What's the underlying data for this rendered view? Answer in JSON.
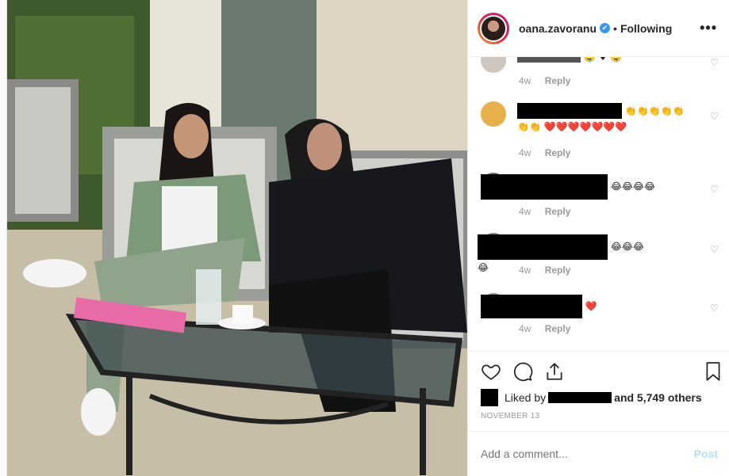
{
  "header": {
    "username": "oana.zavoranu",
    "verified_mark": "✔",
    "separator": "•",
    "follow_status": "Following",
    "more": "•••"
  },
  "comments": [
    {
      "emojis": "🤤 ♥ 🤤",
      "time": "4w",
      "reply": "Reply"
    },
    {
      "emojis": "👏👏👏👏👏👏👏 ❤️❤️❤️❤️❤️❤️❤️",
      "time": "4w",
      "reply": "Reply"
    },
    {
      "emojis": "😂😂😂😂",
      "time": "4w",
      "reply": "Reply"
    },
    {
      "emojis": "😂😂😂😂",
      "time": "4w",
      "reply": "Reply"
    },
    {
      "emojis": "❤️",
      "time": "4w",
      "reply": "Reply"
    }
  ],
  "likes": {
    "prefix": "Liked by",
    "suffix": "and 5,749 others"
  },
  "date": "NOVEMBER 13",
  "add_comment": {
    "placeholder": "Add a comment...",
    "post_label": "Post"
  },
  "icons": [
    "heart-icon",
    "comment-icon",
    "share-icon",
    "bookmark-icon",
    "verified-badge-icon"
  ]
}
